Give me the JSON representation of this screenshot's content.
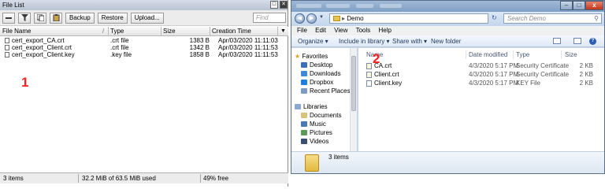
{
  "file_list": {
    "title": "File List",
    "buttons": {
      "maximize": "□",
      "close": "✕",
      "backup": "Backup",
      "restore": "Restore",
      "upload": "Upload..."
    },
    "find_placeholder": "Find",
    "columns": {
      "name": "File Name",
      "type": "Type",
      "size": "Size",
      "creation_time": "Creation Time",
      "sort_marker": "/"
    },
    "rows": [
      {
        "name": "cert_export_CA.crt",
        "type": ".crt file",
        "size": "1383 B",
        "time": "Apr/03/2020 11:11:03"
      },
      {
        "name": "cert_export_Client.crt",
        "type": ".crt file",
        "size": "1342 B",
        "time": "Apr/03/2020 11:11:53"
      },
      {
        "name": "cert_export_Client.key",
        "type": ".key file",
        "size": "1858 B",
        "time": "Apr/03/2020 11:11:53"
      }
    ],
    "annotation": "1",
    "status": {
      "items": "3 items",
      "usage": "32.2 MiB of 63.5 MiB used",
      "free": "49% free"
    }
  },
  "explorer": {
    "path": "Demo",
    "search_placeholder": "Search Demo",
    "menu": [
      "File",
      "Edit",
      "View",
      "Tools",
      "Help"
    ],
    "commands": {
      "organize": "Organize ▾",
      "include": "Include in library ▾",
      "share": "Share with ▾",
      "new_folder": "New folder"
    },
    "nav": {
      "favorites": "Favorites",
      "favorites_items": [
        "Desktop",
        "Downloads",
        "Dropbox",
        "Recent Places"
      ],
      "libraries": "Libraries",
      "libraries_items": [
        "Documents",
        "Music",
        "Pictures",
        "Videos"
      ]
    },
    "columns": {
      "name": "Name",
      "date": "Date modified",
      "type": "Type",
      "size": "Size"
    },
    "rows": [
      {
        "name": "CA.crt",
        "date": "4/3/2020 5:17 PM",
        "type": "Security Certificate",
        "size": "2 KB"
      },
      {
        "name": "Client.crt",
        "date": "4/3/2020 5:17 PM",
        "type": "Security Certificate",
        "size": "2 KB"
      },
      {
        "name": "Client.key",
        "date": "4/3/2020 5:17 PM",
        "type": "KEY File",
        "size": "2 KB"
      }
    ],
    "annotation": "2",
    "details_count": "3 items",
    "controls": {
      "minimize": "–",
      "maximize": "□",
      "close": "x"
    }
  },
  "colors": {
    "annotation": "#ff2020",
    "explorer_frame": "#c8d8ea",
    "folder": "#e8c253"
  }
}
